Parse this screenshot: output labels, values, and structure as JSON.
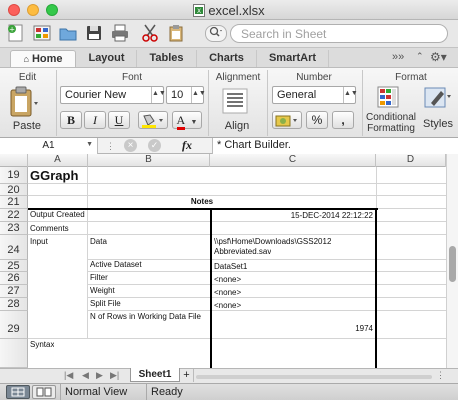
{
  "window": {
    "title": "excel.xlsx"
  },
  "toolbar": {
    "search_placeholder": "Search in Sheet",
    "search_scope_icon": "magnifier-icon"
  },
  "ribbon_tabs": [
    "Home",
    "Layout",
    "Tables",
    "Charts",
    "SmartArt"
  ],
  "ribbon": {
    "groups": {
      "edit": "Edit",
      "font": "Font",
      "alignment": "Alignment",
      "number": "Number",
      "format": "Format"
    },
    "paste_label": "Paste",
    "font_name": "Courier New",
    "font_size": "10",
    "bold": "B",
    "italic": "I",
    "underline": "U",
    "font_color_glyph": "A",
    "align_label": "Align",
    "number_format": "General",
    "percent": "%",
    "comma": ",",
    "conditional_formatting_1": "Conditional",
    "conditional_formatting_2": "Formatting",
    "styles_label": "Styles"
  },
  "formula_bar": {
    "name_box": "A1",
    "fx": "fx",
    "formula": "* Chart Builder."
  },
  "grid": {
    "columns": [
      "A",
      "B",
      "C",
      "D"
    ],
    "rows": [
      {
        "num": "19",
        "a": "GGraph",
        "b": "",
        "c": ""
      },
      {
        "num": "20",
        "a": "",
        "b": "",
        "c": ""
      },
      {
        "num": "21",
        "title": "Notes"
      },
      {
        "num": "22",
        "a": "Output Created",
        "b": "",
        "c": "15-DEC-2014 22:12:22"
      },
      {
        "num": "23",
        "a": "Comments",
        "b": "",
        "c": ""
      },
      {
        "num": "24",
        "a": "Input",
        "b": "Data",
        "c1": "\\\\psf\\Home\\Downloads\\GSS2012",
        "c2": "Abbreviated.sav"
      },
      {
        "num": "25",
        "a": "",
        "b": "Active Dataset",
        "c": "DataSet1"
      },
      {
        "num": "26",
        "a": "",
        "b": "Filter",
        "c": "<none>"
      },
      {
        "num": "27",
        "a": "",
        "b": "Weight",
        "c": "<none>"
      },
      {
        "num": "28",
        "a": "",
        "b": "Split File",
        "c": "<none>"
      },
      {
        "num": "29",
        "a": "",
        "b": "N of Rows in Working Data File",
        "c": "1974"
      },
      {
        "num": "30",
        "a": "Syntax",
        "b": "",
        "c": ""
      }
    ]
  },
  "sheet_tabs": {
    "active": "Sheet1",
    "add": "+"
  },
  "status_bar": {
    "view": "Normal View",
    "state": "Ready"
  },
  "colors": {
    "ribbon_tab_active": "#fafafa",
    "toolbar_bg": "#e8e8e8",
    "grid_line": "#d4d4d4"
  }
}
